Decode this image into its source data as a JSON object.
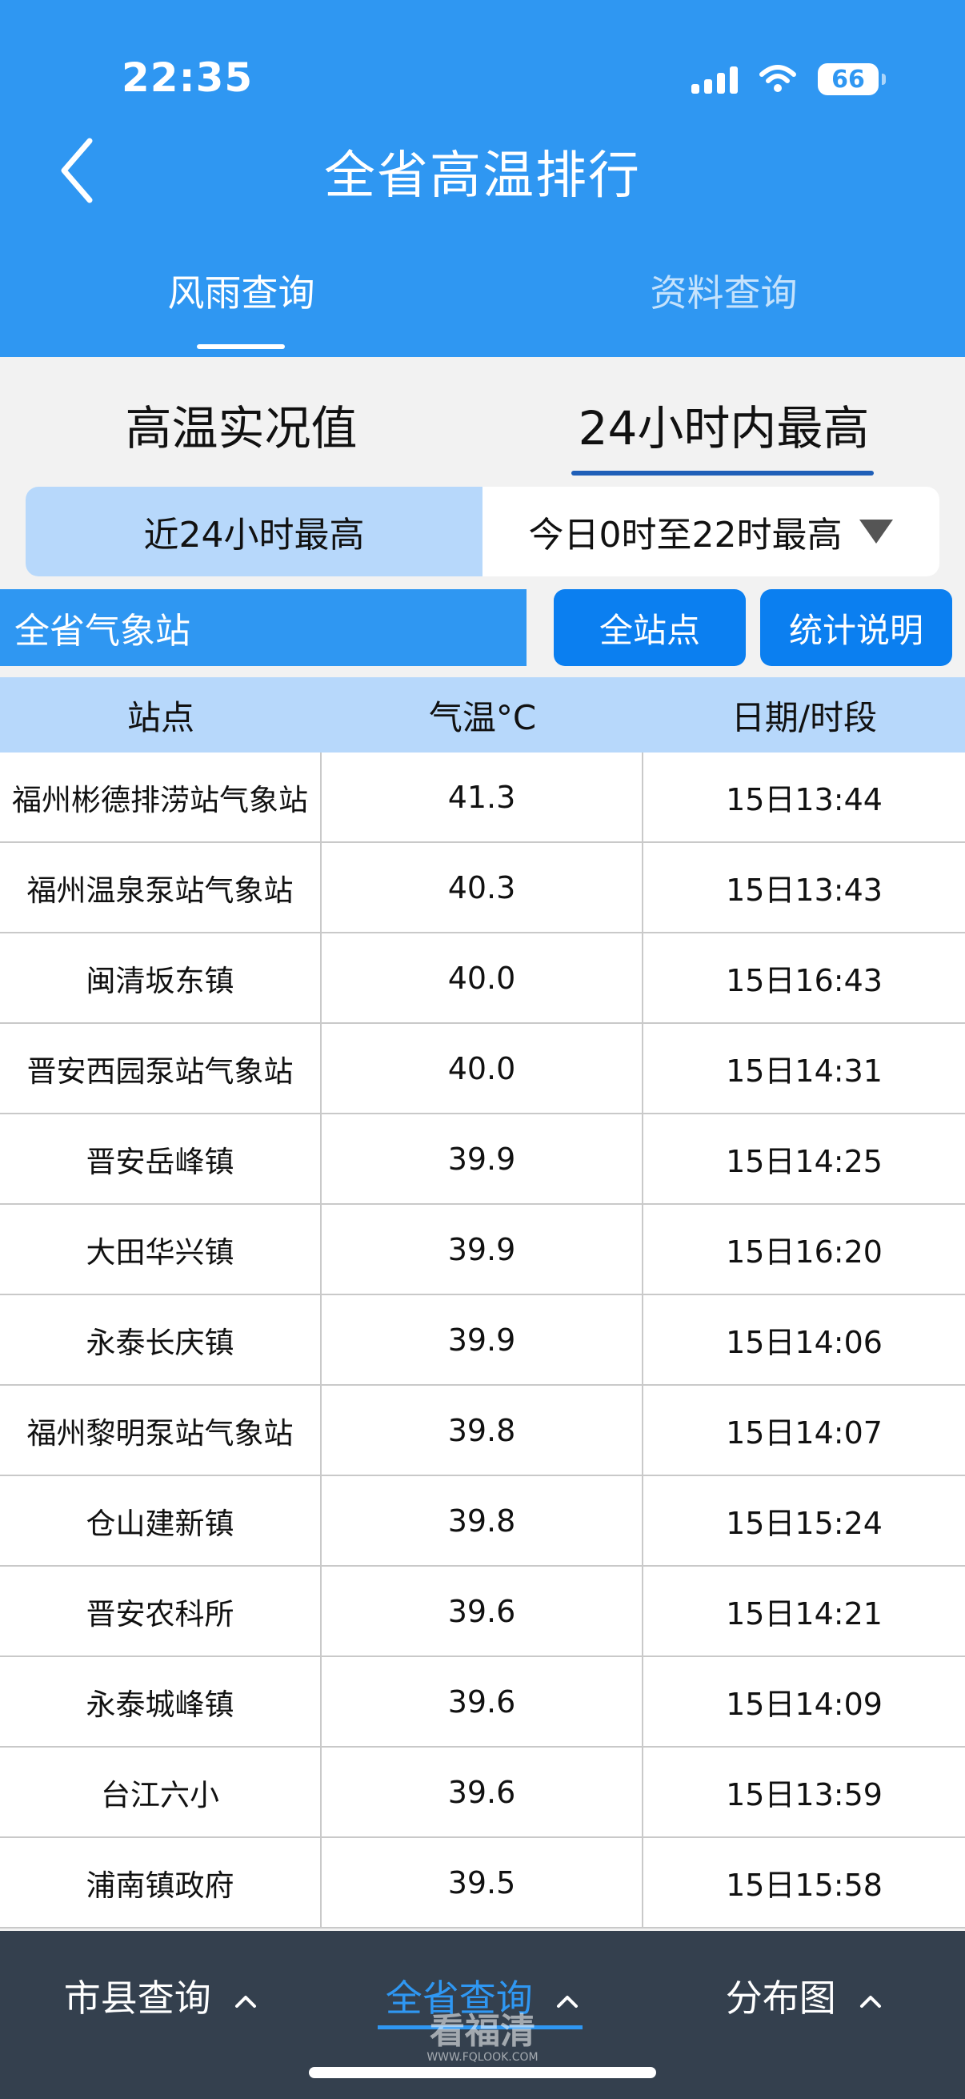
{
  "status": {
    "time": "22:35",
    "battery": "66"
  },
  "header": {
    "title": "全省高温排行"
  },
  "top_tabs": [
    {
      "label": "风雨查询"
    },
    {
      "label": "资料查询"
    }
  ],
  "sub_tabs": [
    {
      "label": "高温实况值"
    },
    {
      "label": "24小时内最高"
    }
  ],
  "segment": {
    "left": "近24小时最高",
    "right": "今日0时至22时最高"
  },
  "filter": {
    "region": "全省气象站",
    "all_stations": "全站点",
    "stats_note": "统计说明"
  },
  "table": {
    "headers": [
      "站点",
      "气温°C",
      "日期/时段"
    ],
    "rows": [
      [
        "福州彬德排涝站气象站",
        "41.3",
        "15日13:44"
      ],
      [
        "福州温泉泵站气象站",
        "40.3",
        "15日13:43"
      ],
      [
        "闽清坂东镇",
        "40.0",
        "15日16:43"
      ],
      [
        "晋安西园泵站气象站",
        "40.0",
        "15日14:31"
      ],
      [
        "晋安岳峰镇",
        "39.9",
        "15日14:25"
      ],
      [
        "大田华兴镇",
        "39.9",
        "15日16:20"
      ],
      [
        "永泰长庆镇",
        "39.9",
        "15日14:06"
      ],
      [
        "福州黎明泵站气象站",
        "39.8",
        "15日14:07"
      ],
      [
        "仓山建新镇",
        "39.8",
        "15日15:24"
      ],
      [
        "晋安农科所",
        "39.6",
        "15日14:21"
      ],
      [
        "永泰城峰镇",
        "39.6",
        "15日14:09"
      ],
      [
        "台江六小",
        "39.6",
        "15日13:59"
      ],
      [
        "浦南镇政府",
        "39.5",
        "15日15:58"
      ]
    ]
  },
  "bottom_nav": [
    {
      "label": "市县查询"
    },
    {
      "label": "全省查询"
    },
    {
      "label": "分布图"
    }
  ],
  "watermark": {
    "title": "看福清",
    "url": "WWW.FQLOOK.COM"
  },
  "colors": {
    "header_blue": "#2f97f2",
    "button_blue": "#0b7ff0",
    "light_blue": "#b7d8fb",
    "bottom_bar": "#34404e"
  }
}
